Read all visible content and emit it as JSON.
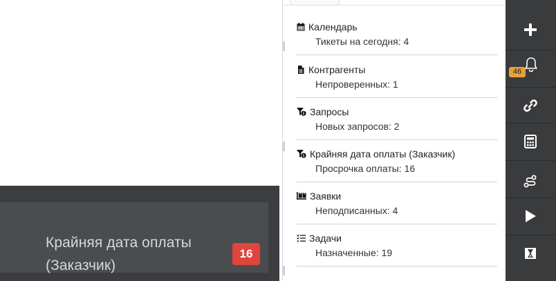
{
  "left_menu": {
    "item_label": "Крайняя дата оплаты (Заказчик)",
    "item_badge": "16"
  },
  "dropdown": {
    "items": [
      {
        "icon": "calendar-icon",
        "title": "Календарь",
        "subtitle": "Тикеты на сегодня: 4"
      },
      {
        "icon": "document-icon",
        "title": "Контрагенты",
        "subtitle": "Непроверенных: 1"
      },
      {
        "icon": "filter-money-icon",
        "title": "Запросы",
        "subtitle": "Новых запросов: 2"
      },
      {
        "icon": "filter-money-icon",
        "title": "Крайняя дата оплаты (Заказчик)",
        "subtitle": "Просрочка оплаты: 16"
      },
      {
        "icon": "pallet-boxes-icon",
        "title": "Заявки",
        "subtitle": "Неподписанных: 4"
      },
      {
        "icon": "task-list-icon",
        "title": "Задачи",
        "subtitle": "Назначенные: 19"
      }
    ]
  },
  "toolbar": {
    "buttons": [
      "plus-icon",
      "bell-icon",
      "link-icon",
      "calculator-icon",
      "route-icon",
      "play-icon",
      "hourglass-icon"
    ],
    "notification_count": "46"
  },
  "colors": {
    "toolbar_bg": "#3a3b3d",
    "badge_red": "#e0453d",
    "badge_orange": "#e8a23a",
    "left_bg": "#3b3d40"
  }
}
